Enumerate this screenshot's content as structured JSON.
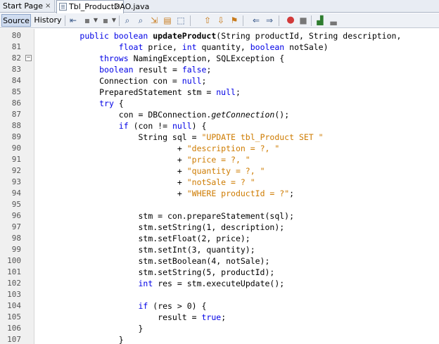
{
  "tabs": {
    "start_page": "Start Page",
    "file": "Tbl_ProductDAO.java",
    "close_glyph": "×"
  },
  "toolbar": {
    "source_label": "Source",
    "history_label": "History"
  },
  "code_lines": [
    {
      "n": "80",
      "tokens": [
        [
          "        ",
          ""
        ],
        [
          "public boolean ",
          "kw"
        ],
        [
          "updateProduct",
          "bold"
        ],
        [
          "(String productId, String description,",
          ""
        ]
      ]
    },
    {
      "n": "81",
      "tokens": [
        [
          "                ",
          ""
        ],
        [
          "float",
          "kw"
        ],
        [
          " price, ",
          ""
        ],
        [
          "int",
          "kw"
        ],
        [
          " quantity, ",
          ""
        ],
        [
          "boolean",
          "kw"
        ],
        [
          " notSale)",
          ""
        ]
      ]
    },
    {
      "n": "82",
      "fold": "−",
      "tokens": [
        [
          "            ",
          ""
        ],
        [
          "throws",
          "kw"
        ],
        [
          " NamingException, SQLException {",
          ""
        ]
      ]
    },
    {
      "n": "83",
      "tokens": [
        [
          "            ",
          ""
        ],
        [
          "boolean",
          "kw"
        ],
        [
          " result = ",
          ""
        ],
        [
          "false",
          "kw"
        ],
        [
          ";",
          ""
        ]
      ]
    },
    {
      "n": "84",
      "tokens": [
        [
          "            Connection con = ",
          ""
        ],
        [
          "null",
          "kw"
        ],
        [
          ";",
          ""
        ]
      ]
    },
    {
      "n": "85",
      "tokens": [
        [
          "            PreparedStatement stm = ",
          ""
        ],
        [
          "null",
          "kw"
        ],
        [
          ";",
          ""
        ]
      ]
    },
    {
      "n": "86",
      "tokens": [
        [
          "            ",
          ""
        ],
        [
          "try",
          "kw"
        ],
        [
          " {",
          ""
        ]
      ]
    },
    {
      "n": "87",
      "tokens": [
        [
          "                con = DBConnection.",
          ""
        ],
        [
          "getConnection",
          "it"
        ],
        [
          "();",
          ""
        ]
      ]
    },
    {
      "n": "88",
      "tokens": [
        [
          "                ",
          ""
        ],
        [
          "if",
          "kw"
        ],
        [
          " (con != ",
          ""
        ],
        [
          "null",
          "kw"
        ],
        [
          ") {",
          ""
        ]
      ]
    },
    {
      "n": "89",
      "tokens": [
        [
          "                    String sql = ",
          ""
        ],
        [
          "\"UPDATE tbl_Product SET \"",
          "str"
        ]
      ]
    },
    {
      "n": "90",
      "tokens": [
        [
          "                            + ",
          ""
        ],
        [
          "\"description = ?, \"",
          "str"
        ]
      ]
    },
    {
      "n": "91",
      "tokens": [
        [
          "                            + ",
          ""
        ],
        [
          "\"price = ?, \"",
          "str"
        ]
      ]
    },
    {
      "n": "92",
      "tokens": [
        [
          "                            + ",
          ""
        ],
        [
          "\"quantity = ?, \"",
          "str"
        ]
      ]
    },
    {
      "n": "93",
      "tokens": [
        [
          "                            + ",
          ""
        ],
        [
          "\"notSale = ? \"",
          "str"
        ]
      ]
    },
    {
      "n": "94",
      "tokens": [
        [
          "                            + ",
          ""
        ],
        [
          "\"WHERE productId = ?\"",
          "str"
        ],
        [
          ";",
          ""
        ]
      ]
    },
    {
      "n": "95",
      "tokens": []
    },
    {
      "n": "96",
      "tokens": [
        [
          "                    stm = con.prepareStatement(sql);",
          ""
        ]
      ]
    },
    {
      "n": "97",
      "tokens": [
        [
          "                    stm.setString(1, description);",
          ""
        ]
      ]
    },
    {
      "n": "98",
      "tokens": [
        [
          "                    stm.setFloat(2, price);",
          ""
        ]
      ]
    },
    {
      "n": "99",
      "tokens": [
        [
          "                    stm.setInt(3, quantity);",
          ""
        ]
      ]
    },
    {
      "n": "100",
      "tokens": [
        [
          "                    stm.setBoolean(4, notSale);",
          ""
        ]
      ]
    },
    {
      "n": "101",
      "tokens": [
        [
          "                    stm.setString(5, productId);",
          ""
        ]
      ]
    },
    {
      "n": "102",
      "tokens": [
        [
          "                    ",
          ""
        ],
        [
          "int",
          "kw"
        ],
        [
          " res = stm.executeUpdate();",
          ""
        ]
      ]
    },
    {
      "n": "103",
      "tokens": []
    },
    {
      "n": "104",
      "tokens": [
        [
          "                    ",
          ""
        ],
        [
          "if",
          "kw"
        ],
        [
          " (res > 0) {",
          ""
        ]
      ]
    },
    {
      "n": "105",
      "tokens": [
        [
          "                        result = ",
          ""
        ],
        [
          "true",
          "kw"
        ],
        [
          ";",
          ""
        ]
      ]
    },
    {
      "n": "106",
      "tokens": [
        [
          "                    }",
          ""
        ]
      ]
    },
    {
      "n": "107",
      "tokens": [
        [
          "                }",
          ""
        ]
      ]
    }
  ],
  "colors": {
    "keyword": "#0000e6",
    "string": "#ce7b00",
    "active_tab": "#ffffff",
    "gutter": "#f0f0f0"
  }
}
